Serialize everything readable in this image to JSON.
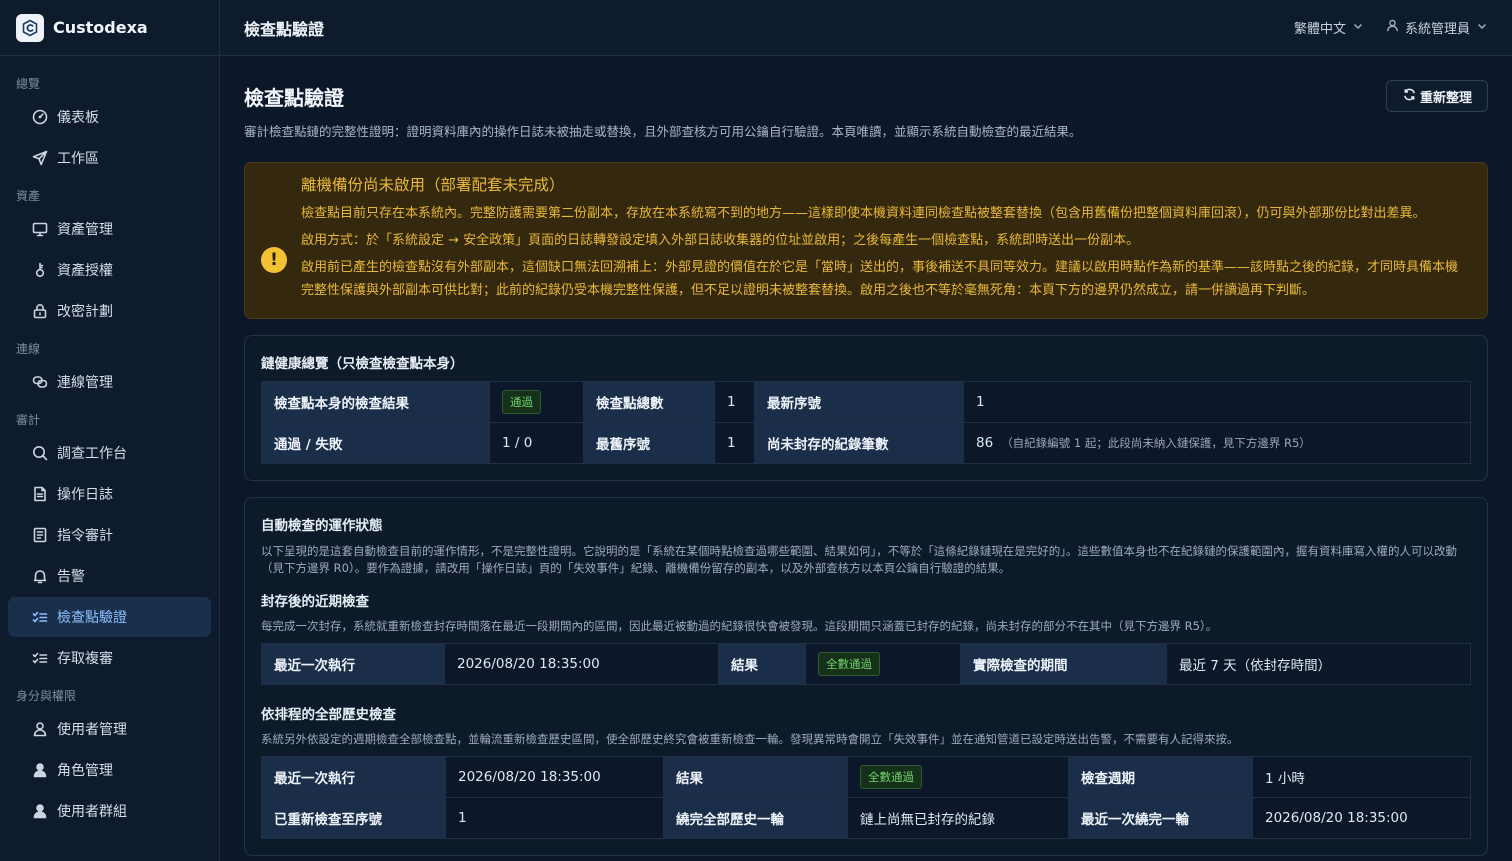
{
  "brand": {
    "name": "Custodexa"
  },
  "sidebar": {
    "groups": [
      {
        "title": "總覽",
        "items": [
          {
            "label": "儀表板",
            "icon": "dashboard-gauge-icon"
          },
          {
            "label": "工作區",
            "icon": "send-arrow-icon"
          }
        ]
      },
      {
        "title": "資產",
        "items": [
          {
            "label": "資產管理",
            "icon": "monitor-icon"
          },
          {
            "label": "資產授權",
            "icon": "key-icon"
          },
          {
            "label": "改密計劃",
            "icon": "lock-icon"
          }
        ]
      },
      {
        "title": "連線",
        "items": [
          {
            "label": "連線管理",
            "icon": "link-icon"
          }
        ]
      },
      {
        "title": "審計",
        "items": [
          {
            "label": "調查工作台",
            "icon": "search-icon"
          },
          {
            "label": "操作日誌",
            "icon": "document-icon"
          },
          {
            "label": "指令審計",
            "icon": "clipboard-icon"
          },
          {
            "label": "告警",
            "icon": "bell-icon"
          },
          {
            "label": "檢查點驗證",
            "icon": "list-check-icon",
            "active": true
          },
          {
            "label": "存取複審",
            "icon": "list-check-icon"
          }
        ]
      },
      {
        "title": "身分與權限",
        "items": [
          {
            "label": "使用者管理",
            "icon": "user-icon"
          },
          {
            "label": "角色管理",
            "icon": "user-solid-icon"
          },
          {
            "label": "使用者群組",
            "icon": "users-icon"
          }
        ]
      }
    ]
  },
  "topbar": {
    "title": "檢查點驗證",
    "language": "繁體中文",
    "user": "系統管理員"
  },
  "page": {
    "title": "檢查點驗證",
    "description": "審計檢查點鏈的完整性證明：證明資料庫內的操作日誌未被抽走或替換，且外部查核方可用公鑰自行驗證。本頁唯讀，並顯示系統自動檢查的最近結果。",
    "refresh_label": "重新整理"
  },
  "alert": {
    "title": "離機備份尚未啟用（部署配套未完成）",
    "p1": "檢查點目前只存在本系統內。完整防護需要第二份副本，存放在本系統寫不到的地方——這樣即使本機資料連同檢查點被整套替換（包含用舊備份把整個資料庫回滾），仍可與外部那份比對出差異。",
    "p2": "啟用方式：於「系統設定 → 安全政策」頁面的日誌轉發設定填入外部日誌收集器的位址並啟用；之後每產生一個檢查點，系統即時送出一份副本。",
    "p3": "啟用前已產生的檢查點沒有外部副本，這個缺口無法回溯補上：外部見證的價值在於它是「當時」送出的，事後補送不具同等效力。建議以啟用時點作為新的基準——該時點之後的紀錄，才同時具備本機完整性保護與外部副本可供比對；此前的紀錄仍受本機完整性保護，但不足以證明未被整套替換。啟用之後也不等於毫無死角：本頁下方的邊界仍然成立，請一併讀過再下判斷。",
    "accent": "#e9b83a"
  },
  "health": {
    "title": "鏈健康總覽（只檢查檢查點本身）",
    "result_label": "檢查點本身的檢查結果",
    "result_value": "通過",
    "total_label": "檢查點總數",
    "total_value": "1",
    "latest_seq_label": "最新序號",
    "latest_seq_value": "1",
    "pass_fail_label": "通過 / 失敗",
    "pass_fail_value": "1 / 0",
    "oldest_seq_label": "最舊序號",
    "oldest_seq_value": "1",
    "unsealed_label": "尚未封存的紀錄筆數",
    "unsealed_value": "86",
    "unsealed_note": "（自紀錄編號 1 起；此段尚未納入鏈保護，見下方邊界 R5）"
  },
  "auto": {
    "title": "自動檢查的運作狀態",
    "description": "以下呈現的是這套自動檢查目前的運作情形，不是完整性證明。它說明的是「系統在某個時點檢查過哪些範圍、結果如何」，不等於「這條紀錄鏈現在是完好的」。這些數值本身也不在紀錄鏈的保護範圍內，握有資料庫寫入權的人可以改動（見下方邊界 R0）。要作為證據，請改用「操作日誌」頁的「失效事件」紀錄、離機備份留存的副本，以及外部查核方以本頁公鑰自行驗證的結果。",
    "recent": {
      "title": "封存後的近期檢查",
      "description": "每完成一次封存，系統就重新檢查封存時間落在最近一段期間內的區間，因此最近被動過的紀錄很快會被發現。這段期間只涵蓋已封存的紀錄，尚未封存的部分不在其中（見下方邊界 R5）。",
      "last_run_label": "最近一次執行",
      "last_run_value": "2026/08/20 18:35:00",
      "result_label": "結果",
      "result_value": "全數通過",
      "period_label": "實際檢查的期間",
      "period_value": "最近 7 天（依封存時間）"
    },
    "full": {
      "title": "依排程的全部歷史檢查",
      "description": "系統另外依設定的週期檢查全部檢查點，並輪流重新檢查歷史區間，使全部歷史終究會被重新檢查一輪。發現異常時會開立「失效事件」並在通知管道已設定時送出告警，不需要有人記得來按。",
      "last_run_label": "最近一次執行",
      "last_run_value": "2026/08/20 18:35:00",
      "result_label": "結果",
      "result_value": "全數通過",
      "cycle_label": "檢查週期",
      "cycle_value": "1 小時",
      "rechecked_label": "已重新檢查至序號",
      "rechecked_value": "1",
      "round_label": "繞完全部歷史一輪",
      "round_value": "鏈上尚無已封存的紀錄",
      "last_round_label": "最近一次繞完一輪",
      "last_round_value": "2026/08/20 18:35:00"
    }
  }
}
